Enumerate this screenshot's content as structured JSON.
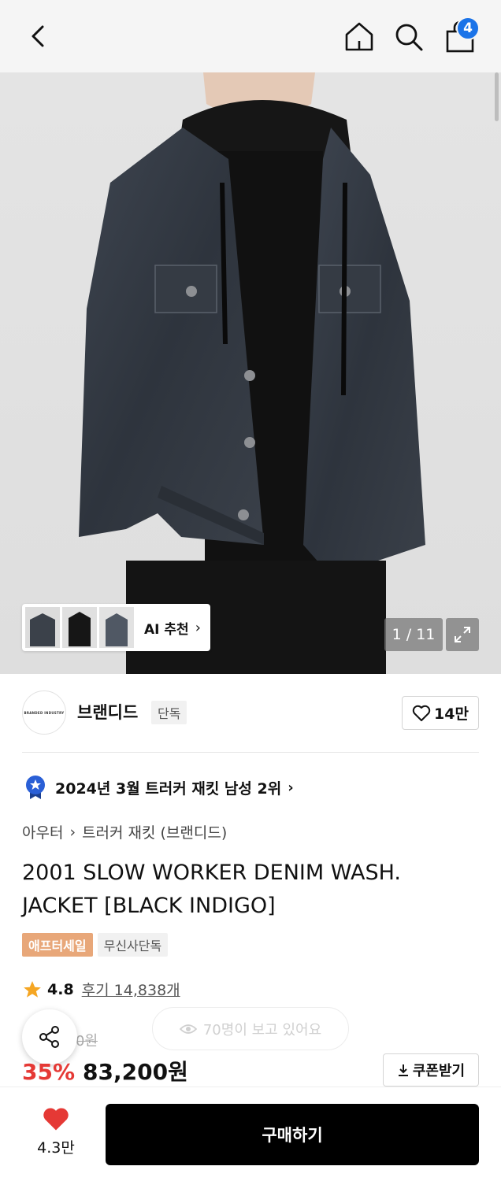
{
  "header": {
    "back_icon": "chevron-left-icon",
    "home_icon": "home-icon",
    "search_icon": "search-icon",
    "bag_icon": "shopping-bag-icon",
    "bag_count": "4",
    "badge_color": "#1a73e8"
  },
  "gallery": {
    "ai_label": "AI 추천",
    "counter": "1 / 11"
  },
  "brand": {
    "logo_text": "BRANDED INDUSTRY",
    "name": "브랜디드",
    "tag": "단독",
    "like_count": "14만"
  },
  "ranking": {
    "text": "2024년 3월 트러커 재킷 남성 2위"
  },
  "breadcrumb": {
    "level1": "아우터",
    "level2": "트러커 재킷 (브랜디드)"
  },
  "product": {
    "title": "2001 SLOW WORKER DENIM WASH. JACKET [BLACK INDIGO]",
    "badges": [
      "애프터세일",
      "무신사단독"
    ],
    "rating": "4.8",
    "reviews": "후기 14,838개",
    "viewers": "70명이 보고 있어요",
    "original_price": "0원",
    "discount": "35%",
    "price": "83,200원",
    "coupon_label": "쿠폰받기"
  },
  "bottom": {
    "wish_count": "4.3만",
    "buy_label": "구매하기",
    "accent_red": "#e53935"
  }
}
